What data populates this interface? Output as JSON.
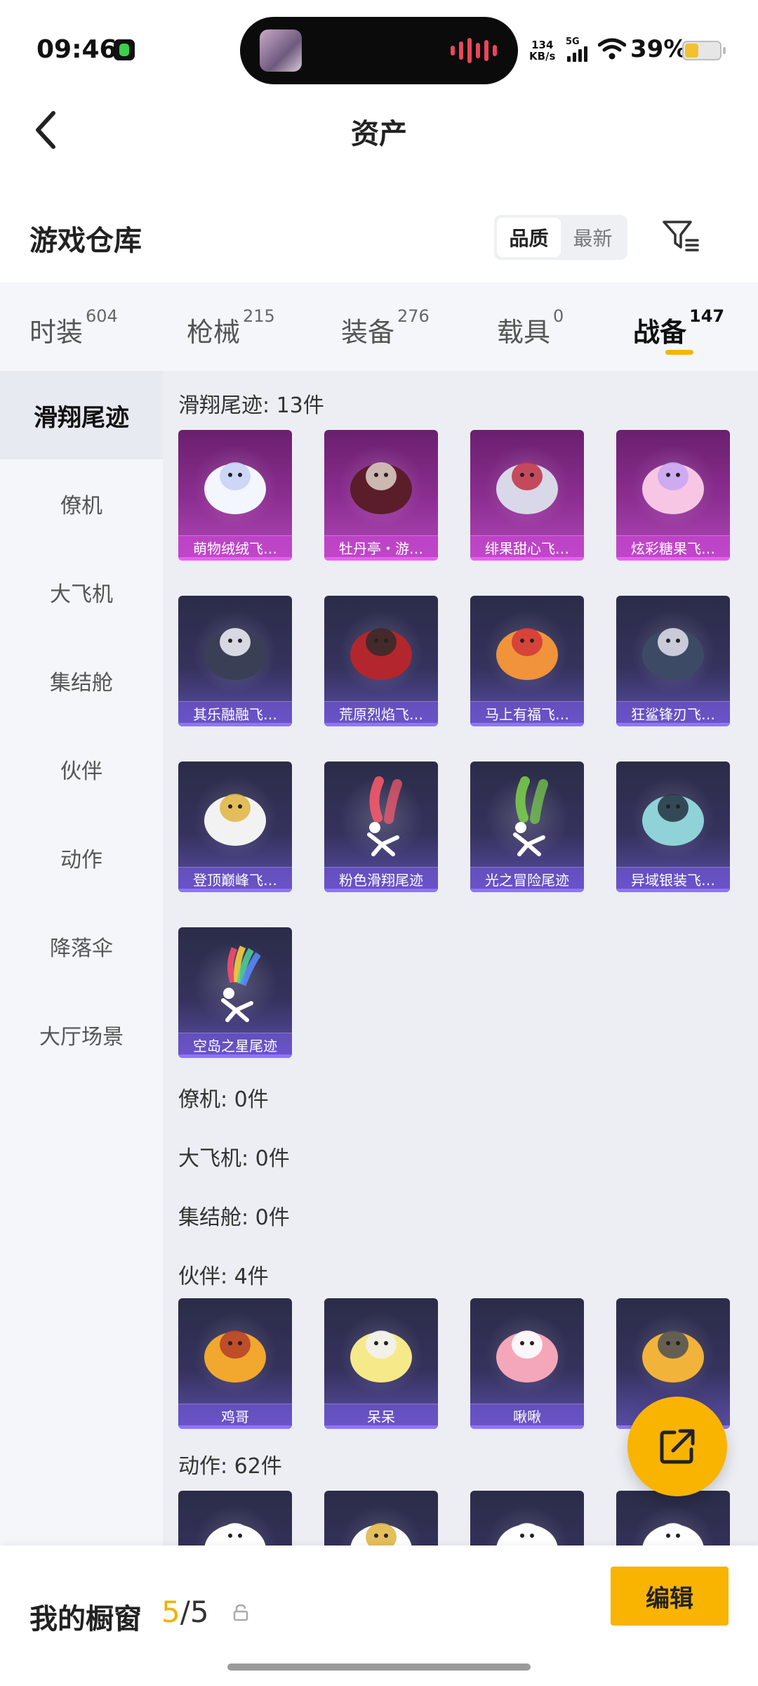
{
  "status_bar": {
    "time": "09:46",
    "network_speed_value": "134",
    "network_speed_unit": "KB/s",
    "signal_label": "5G",
    "battery_percent": "39%",
    "battery_level": 0.39,
    "icons": [
      "app-notification-icon",
      "media-thumbnail-icon",
      "audio-wave-icon",
      "signal-icon",
      "wifi-icon",
      "battery-icon"
    ]
  },
  "nav": {
    "title": "资产",
    "back_icon": "chevron-left-icon"
  },
  "warehouse": {
    "title": "游戏仓库",
    "sort_options": [
      "品质",
      "最新"
    ],
    "sort_selected": "品质",
    "filter_icon": "filter-icon"
  },
  "tabs": [
    {
      "label": "时装",
      "count": "604"
    },
    {
      "label": "枪械",
      "count": "215"
    },
    {
      "label": "装备",
      "count": "276"
    },
    {
      "label": "载具",
      "count": "0"
    },
    {
      "label": "战备",
      "count": "147",
      "active": true
    }
  ],
  "side_nav": [
    {
      "label": "滑翔尾迹",
      "active": true
    },
    {
      "label": "僚机"
    },
    {
      "label": "大飞机"
    },
    {
      "label": "集结舱"
    },
    {
      "label": "伙伴"
    },
    {
      "label": "动作"
    },
    {
      "label": "降落伞"
    },
    {
      "label": "大厅场景"
    }
  ],
  "groups": {
    "glide_trails": {
      "heading": "滑翔尾迹: 13件",
      "items": [
        {
          "name": "萌物绒绒飞…",
          "rarity": "epic",
          "icon": "plush-bunny-icon"
        },
        {
          "name": "牡丹亭・游…",
          "rarity": "epic",
          "icon": "ornament-wings-icon"
        },
        {
          "name": "绯果甜心飞…",
          "rarity": "epic",
          "icon": "fruit-mask-icon"
        },
        {
          "name": "炫彩糖果飞…",
          "rarity": "epic",
          "icon": "candy-crystal-icon"
        },
        {
          "name": "其乐融融飞…",
          "rarity": "rare",
          "icon": "penguin-icon"
        },
        {
          "name": "荒原烈焰飞…",
          "rarity": "rare",
          "icon": "flame-wings-icon"
        },
        {
          "name": "马上有福飞…",
          "rarity": "rare",
          "icon": "toy-horse-icon"
        },
        {
          "name": "狂鲨锋刃飞…",
          "rarity": "rare",
          "icon": "shark-icon"
        },
        {
          "name": "登顶巅峰飞…",
          "rarity": "rare",
          "icon": "jet-glider-icon"
        },
        {
          "name": "粉色滑翔尾迹",
          "rarity": "rare",
          "icon": "pink-smoke-icon",
          "smoke": "#ff5b6a"
        },
        {
          "name": "光之冒险尾迹",
          "rarity": "rare",
          "icon": "green-smoke-icon",
          "smoke": "#7bd34a"
        },
        {
          "name": "异域银装飞…",
          "rarity": "rare",
          "icon": "silver-wings-icon"
        },
        {
          "name": "空岛之星尾迹",
          "rarity": "rare",
          "icon": "rainbow-smoke-icon",
          "smoke": "rainbow"
        }
      ]
    },
    "wingman": {
      "heading": "僚机: 0件"
    },
    "large_plane": {
      "heading": "大飞机: 0件"
    },
    "assembly_pod": {
      "heading": "集结舱: 0件"
    },
    "companions": {
      "heading": "伙伴: 4件",
      "items": [
        {
          "name": "鸡哥",
          "rarity": "rare",
          "icon": "chicken-sunglasses-icon"
        },
        {
          "name": "呆呆",
          "rarity": "rare",
          "icon": "chick-icon"
        },
        {
          "name": "啾啾",
          "rarity": "rare",
          "icon": "pink-bird-icon"
        },
        {
          "name": "",
          "rarity": "rare",
          "icon": "helmet-chick-icon"
        }
      ]
    },
    "emotes": {
      "heading": "动作: 62件",
      "items": [
        {
          "name": "",
          "rarity": "rare",
          "icon": "pose-figure-icon"
        },
        {
          "name": "",
          "rarity": "rare",
          "icon": "trophy-pose-icon"
        },
        {
          "name": "",
          "rarity": "rare",
          "icon": "dance-pose-icon"
        },
        {
          "name": "",
          "rarity": "rare",
          "icon": "music-dance-icon"
        }
      ]
    }
  },
  "fab": {
    "icon": "share-external-icon"
  },
  "bottom_bar": {
    "label": "我的橱窗",
    "count_current": "5",
    "count_total": "/5",
    "lock_icon": "lock-icon",
    "edit_label": "编辑"
  },
  "colors": {
    "accent": "#f8b400",
    "epic_card": "#8a2d8f",
    "rare_card": "#35325d",
    "tab_bg": "#f4f6fa"
  }
}
